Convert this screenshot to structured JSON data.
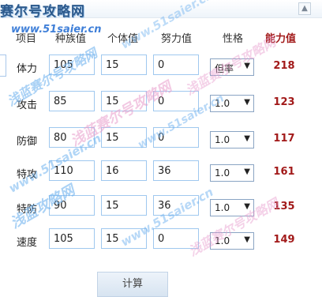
{
  "window": {
    "close_glyph": "▲"
  },
  "logo": {
    "title": "赛尔号攻略网",
    "subtitle": "www.51saier.cn"
  },
  "header": {
    "item": "项目",
    "base": "种族值",
    "iv": "个体值",
    "ev": "努力值",
    "nature": "性格",
    "power": "能力值"
  },
  "rows": [
    {
      "label": "体力",
      "base": "105",
      "iv": "15",
      "ev": "0",
      "nature": "但率",
      "power": "218"
    },
    {
      "label": "攻击",
      "base": "85",
      "iv": "15",
      "ev": "0",
      "nature": "1.0",
      "power": "123"
    },
    {
      "label": "防御",
      "base": "80",
      "iv": "15",
      "ev": "0",
      "nature": "1.0",
      "power": "117"
    },
    {
      "label": "特攻",
      "base": "110",
      "iv": "16",
      "ev": "36",
      "nature": "1.0",
      "power": "161"
    },
    {
      "label": "特防",
      "base": "90",
      "iv": "15",
      "ev": "36",
      "nature": "1.0",
      "power": "135"
    },
    {
      "label": "速度",
      "base": "105",
      "iv": "15",
      "ev": "0",
      "nature": "1.0",
      "power": "149"
    }
  ],
  "calc_button": "计算",
  "watermarks": {
    "site_cn": "浅蓝赛尔号攻略网",
    "site_url": "www.51saier.cn",
    "site_short": "浅蓝攻略网"
  },
  "colors": {
    "accent_red": "#a21a1a",
    "field_border": "#9fc8ef",
    "watermark_blue": "#6fb2ef",
    "watermark_pink": "#e79acb"
  }
}
